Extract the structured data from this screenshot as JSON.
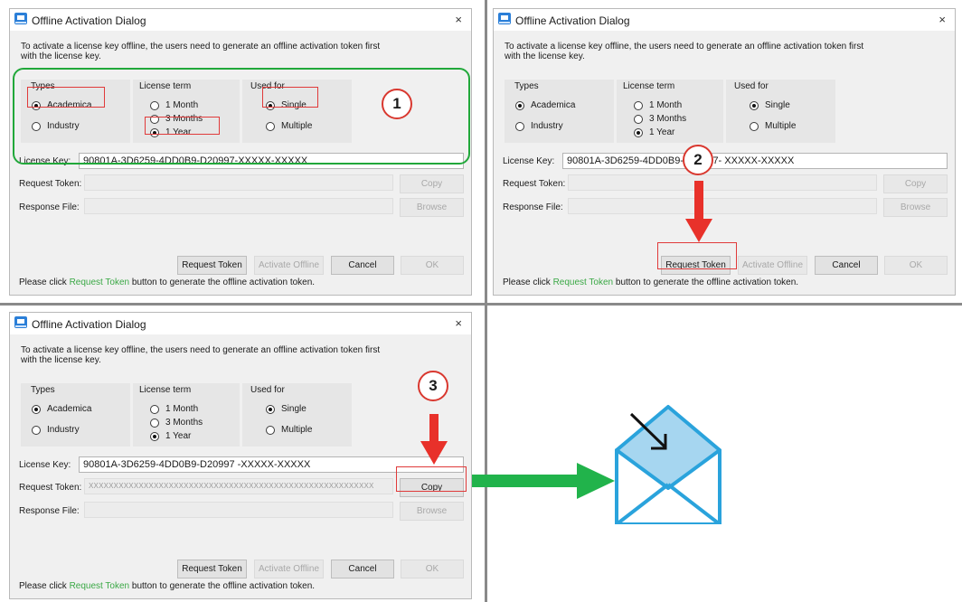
{
  "dialog": {
    "title": "Offline Activation Dialog",
    "close_glyph": "×",
    "intro": "To activate a license key offline, the users need to generate an offline activation token first with the license key.",
    "types_header": "Types",
    "types_options": [
      "Academica",
      "Industry"
    ],
    "term_header": "License term",
    "term_options": [
      "1 Month",
      "3 Months",
      "1 Year"
    ],
    "used_header": "Used for",
    "used_options": [
      "Single",
      "Multiple"
    ],
    "selected": {
      "type": "Academica",
      "term": "1 Year",
      "used_for": "Single"
    },
    "license_key_label": "License Key:",
    "request_token_label": "Request Token:",
    "response_file_label": "Response File:",
    "buttons": {
      "copy": "Copy",
      "browse": "Browse",
      "request": "Request Token",
      "activate": "Activate Offline",
      "cancel": "Cancel",
      "ok": "OK"
    },
    "status": {
      "prefix": "Please click ",
      "link": "Request Token",
      "suffix": " button to generate the offline activation token."
    }
  },
  "panels": [
    {
      "license_key": "90801A-3D6259-4DD0B9-D20997-XXXXX-XXXXX",
      "request_token": ""
    },
    {
      "license_key": "90801A-3D6259-4DD0B9-D20997- XXXXX-XXXXX",
      "request_token": ""
    },
    {
      "license_key": "90801A-3D6259-4DD0B9-D20997 -XXXXX-XXXXX",
      "request_token": "XXXXXXXXXXXXXXXXXXXXXXXXXXXXXXXXXXXXXXXXXXXXXXXXXXXXXXXXX"
    }
  ],
  "steps": [
    "1",
    "2",
    "3"
  ],
  "icons": {
    "email": "envelope-arrow-icon",
    "flow": "green-arrow-icon",
    "pointer": "red-arrow-icon",
    "window": "app-window-icon"
  },
  "colors": {
    "link": "#3aa845",
    "highlight": "#e03a3a",
    "group_outline": "#21a83a",
    "step_circle": "#d9382f",
    "email_fill": "#a6d6f0",
    "email_stroke": "#2aa3dc",
    "flow_arrow": "#21b34b"
  }
}
